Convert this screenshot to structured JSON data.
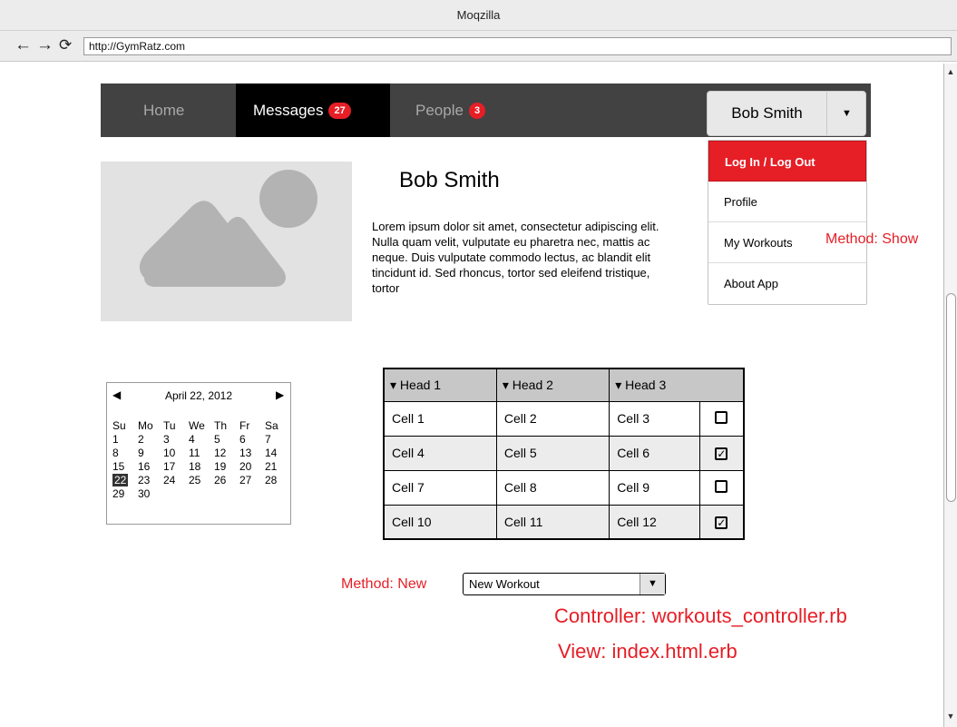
{
  "browser": {
    "title": "Moqzilla",
    "back_glyph": "←",
    "forward_glyph": "→",
    "reload_glyph": "⟳",
    "url": "http://GymRatz.com"
  },
  "navbar": {
    "home": "Home",
    "messages": "Messages",
    "messages_count": "27",
    "people": "People",
    "people_count": "3",
    "user_name": "Bob Smith",
    "caret_glyph": "▼"
  },
  "dropdown": {
    "items": [
      {
        "label": "Log In / Log Out"
      },
      {
        "label": "Profile"
      },
      {
        "label": "My Workouts"
      },
      {
        "label": "About App"
      }
    ]
  },
  "annotations": {
    "method_show": "Method: Show",
    "method_new": "Method: New",
    "controller": "Controller: workouts_controller.rb",
    "view": "View: index.html.erb"
  },
  "profile": {
    "name": "Bob Smith",
    "bio": "Lorem ipsum dolor sit amet, consectetur adipiscing elit. Nulla quam velit, vulputate eu pharetra nec, mattis ac neque. Duis vulputate commodo lectus, ac blandit elit tincidunt id. Sed rhoncus, tortor sed eleifend tristique, tortor"
  },
  "calendar": {
    "title": "April 22, 2012",
    "prev_glyph": "◀",
    "next_glyph": "▶",
    "weekdays": [
      "Su",
      "Mo",
      "Tu",
      "We",
      "Th",
      "Fr",
      "Sa"
    ],
    "weeks": [
      [
        "1",
        "2",
        "3",
        "4",
        "5",
        "6",
        "7"
      ],
      [
        "8",
        "9",
        "10",
        "11",
        "12",
        "13",
        "14"
      ],
      [
        "15",
        "16",
        "17",
        "18",
        "19",
        "20",
        "21"
      ],
      [
        "22",
        "23",
        "24",
        "25",
        "26",
        "27",
        "28"
      ],
      [
        "29",
        "30",
        "",
        "",
        "",
        "",
        ""
      ]
    ],
    "selected": "22"
  },
  "table": {
    "headers": [
      "▾ Head 1",
      "▾ Head 2",
      "▾ Head 3"
    ],
    "rows": [
      {
        "cells": [
          "Cell 1",
          "Cell 2",
          "Cell 3"
        ],
        "checked": false
      },
      {
        "cells": [
          "Cell 4",
          "Cell 5",
          "Cell 6"
        ],
        "checked": true
      },
      {
        "cells": [
          "Cell 7",
          "Cell 8",
          "Cell 9"
        ],
        "checked": false
      },
      {
        "cells": [
          "Cell 10",
          "Cell 11",
          "Cell 12"
        ],
        "checked": true
      }
    ]
  },
  "select": {
    "value": "New Workout",
    "arrow_glyph": "▼"
  },
  "scrollbar": {
    "up_glyph": "▲",
    "down_glyph": "▼"
  },
  "colors": {
    "accent": "#e61e26",
    "navbar_bg": "#424242"
  }
}
